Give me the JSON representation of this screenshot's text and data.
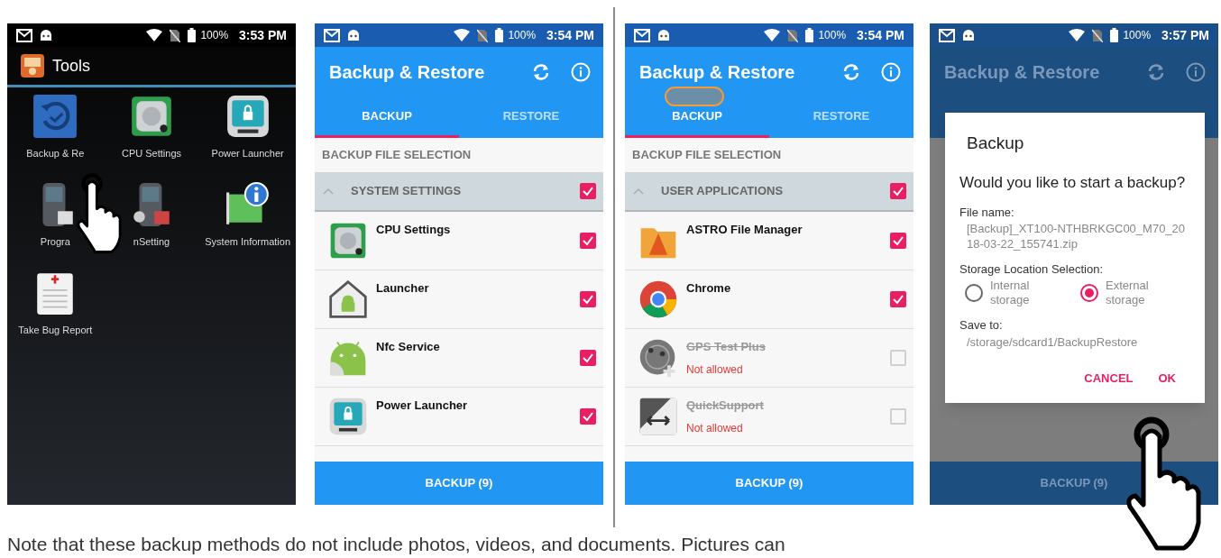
{
  "screens": [
    {
      "kind": "launcher",
      "status_bar": {
        "battery": "100%",
        "time": "3:53 PM"
      },
      "title": "Tools",
      "apps": [
        {
          "label": "Backup & Re"
        },
        {
          "label": "CPU Settings"
        },
        {
          "label": "Power Launcher"
        },
        {
          "label": "Progra"
        },
        {
          "label": "nSetting"
        },
        {
          "label": "System Information"
        },
        {
          "label": "Take Bug Report"
        }
      ]
    },
    {
      "kind": "app",
      "status_bar": {
        "battery": "100%",
        "time": "3:54 PM"
      },
      "title": "Backup & Restore",
      "tabs": [
        {
          "label": "BACKUP",
          "selected": true
        },
        {
          "label": "RESTORE",
          "selected": false
        }
      ],
      "section": "BACKUP FILE SELECTION",
      "group": {
        "label": "SYSTEM SETTINGS",
        "expanded": true,
        "checked": true
      },
      "items": [
        {
          "name": "CPU Settings",
          "checked": true,
          "disabled": false
        },
        {
          "name": "Launcher",
          "checked": true,
          "disabled": false
        },
        {
          "name": "Nfc Service",
          "checked": true,
          "disabled": false
        },
        {
          "name": "Power Launcher",
          "checked": true,
          "disabled": false
        }
      ],
      "footer": "BACKUP (9)"
    },
    {
      "kind": "app",
      "status_bar": {
        "battery": "100%",
        "time": "3:54 PM"
      },
      "title": "Backup & Restore",
      "tabs": [
        {
          "label": "BACKUP",
          "selected": true
        },
        {
          "label": "RESTORE",
          "selected": false
        }
      ],
      "section": "BACKUP FILE SELECTION",
      "group": {
        "label": "USER APPLICATIONS",
        "expanded": true,
        "checked": true
      },
      "items": [
        {
          "name": "ASTRO File Manager",
          "checked": true,
          "disabled": false
        },
        {
          "name": "Chrome",
          "checked": true,
          "disabled": false
        },
        {
          "name": "GPS Test Plus",
          "checked": false,
          "disabled": true,
          "note": "Not allowed"
        },
        {
          "name": "QuickSupport",
          "checked": false,
          "disabled": true,
          "note": "Not allowed"
        }
      ],
      "footer": "BACKUP (9)"
    },
    {
      "kind": "dialog",
      "status_bar": {
        "battery": "100%",
        "time": "3:57 PM"
      },
      "title": "Backup & Restore",
      "footer": "BACKUP (9)",
      "dialog": {
        "title": "Backup",
        "message": "Would you like to start a backup?",
        "file_label": "File name:",
        "file_name": "[Backup]_XT100-NTHBRKGC00_M70_2018-03-22_155741.zip",
        "storage_label": "Storage Location Selection:",
        "options": [
          {
            "label": "Internal storage",
            "selected": false
          },
          {
            "label": "External storage",
            "selected": true
          }
        ],
        "save_label": "Save to:",
        "save_path": "/storage/sdcard1/BackupRestore",
        "buttons": [
          "CANCEL",
          "OK"
        ]
      }
    }
  ],
  "caption": "Note that these backup methods do not include photos, videos, and documents. Pictures can"
}
